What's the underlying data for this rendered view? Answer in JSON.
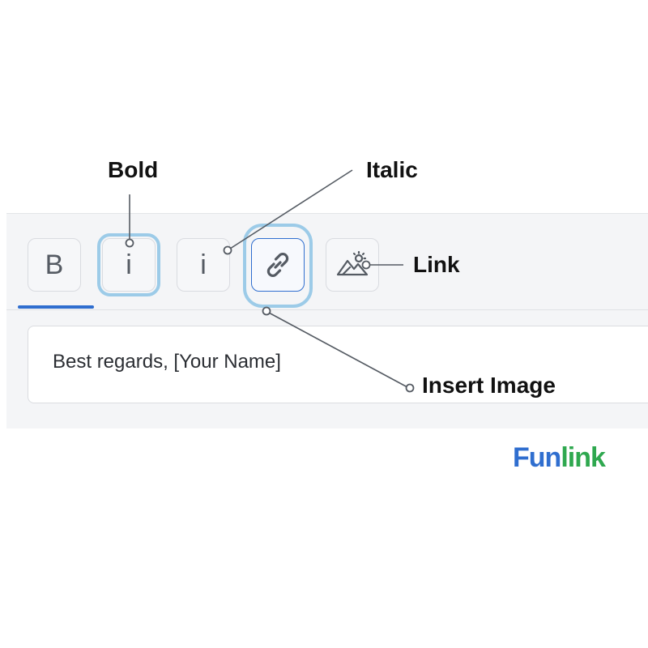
{
  "toolbar": {
    "buttons": [
      {
        "label": "B",
        "icon": "bold-icon"
      },
      {
        "label": "i",
        "icon": "italic-icon"
      },
      {
        "label": "i",
        "icon": "italic-icon"
      },
      {
        "label": "",
        "icon": "link-icon"
      },
      {
        "label": "",
        "icon": "insert-image-icon"
      }
    ]
  },
  "compose": {
    "text": "Best regards, [Your Name]"
  },
  "callouts": {
    "bold": "Bold",
    "italic": "Italic",
    "link": "Link",
    "insert_image": "Insert Image"
  },
  "logo": {
    "part_a": "Fun",
    "part_b": "link"
  },
  "colors": {
    "accent": "#2f6ecf",
    "highlight_halo": "#9ccbe8",
    "logo_blue": "#2f6ecf",
    "logo_green": "#2fa84f"
  }
}
